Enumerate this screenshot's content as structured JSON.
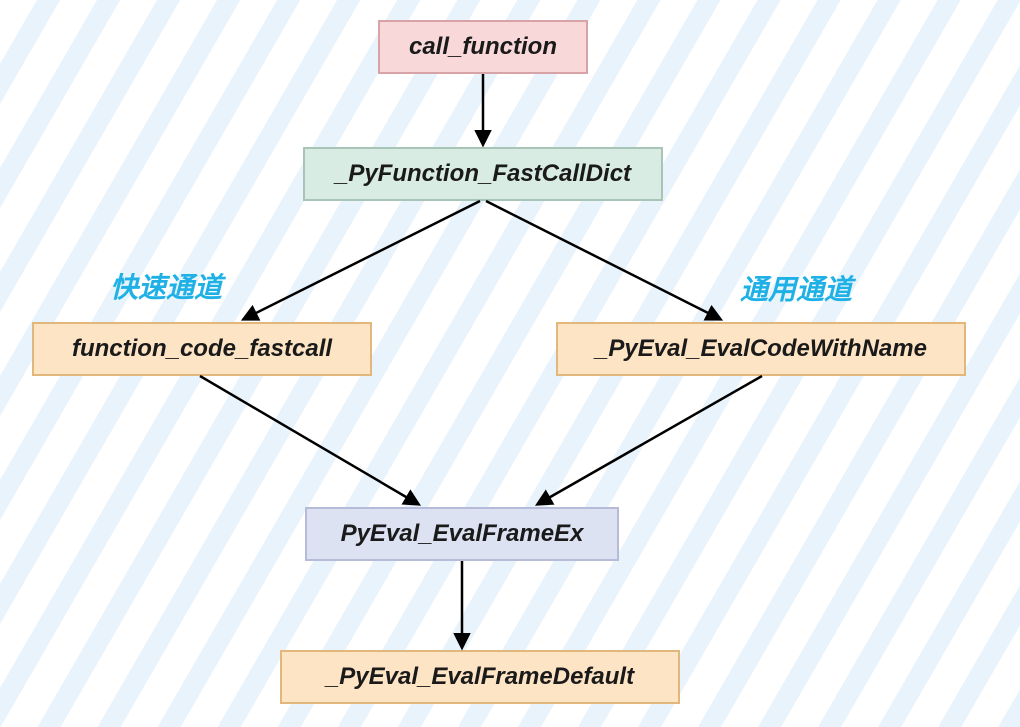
{
  "diagram": {
    "nodes": {
      "call_function": "call_function",
      "pyfunction_fastcalldict": "_PyFunction_FastCallDict",
      "function_code_fastcall": "function_code_fastcall",
      "pyeval_evalcodewithname": "_PyEval_EvalCodeWithName",
      "pyeval_evalframeex": "PyEval_EvalFrameEx",
      "pyeval_evalframedefault": "_PyEval_EvalFrameDefault"
    },
    "labels": {
      "fast_path": "快速通道",
      "general_path": "通用通道"
    },
    "edges": [
      {
        "from": "call_function",
        "to": "pyfunction_fastcalldict"
      },
      {
        "from": "pyfunction_fastcalldict",
        "to": "function_code_fastcall"
      },
      {
        "from": "pyfunction_fastcalldict",
        "to": "pyeval_evalcodewithname"
      },
      {
        "from": "function_code_fastcall",
        "to": "pyeval_evalframeex"
      },
      {
        "from": "pyeval_evalcodewithname",
        "to": "pyeval_evalframeex"
      },
      {
        "from": "pyeval_evalframeex",
        "to": "pyeval_evalframedefault"
      }
    ],
    "colors": {
      "pink": "#f9d8da",
      "green": "#d8ece3",
      "orange": "#fde4c4",
      "blue": "#dde2f3",
      "label_text": "#1fb1e6"
    }
  }
}
